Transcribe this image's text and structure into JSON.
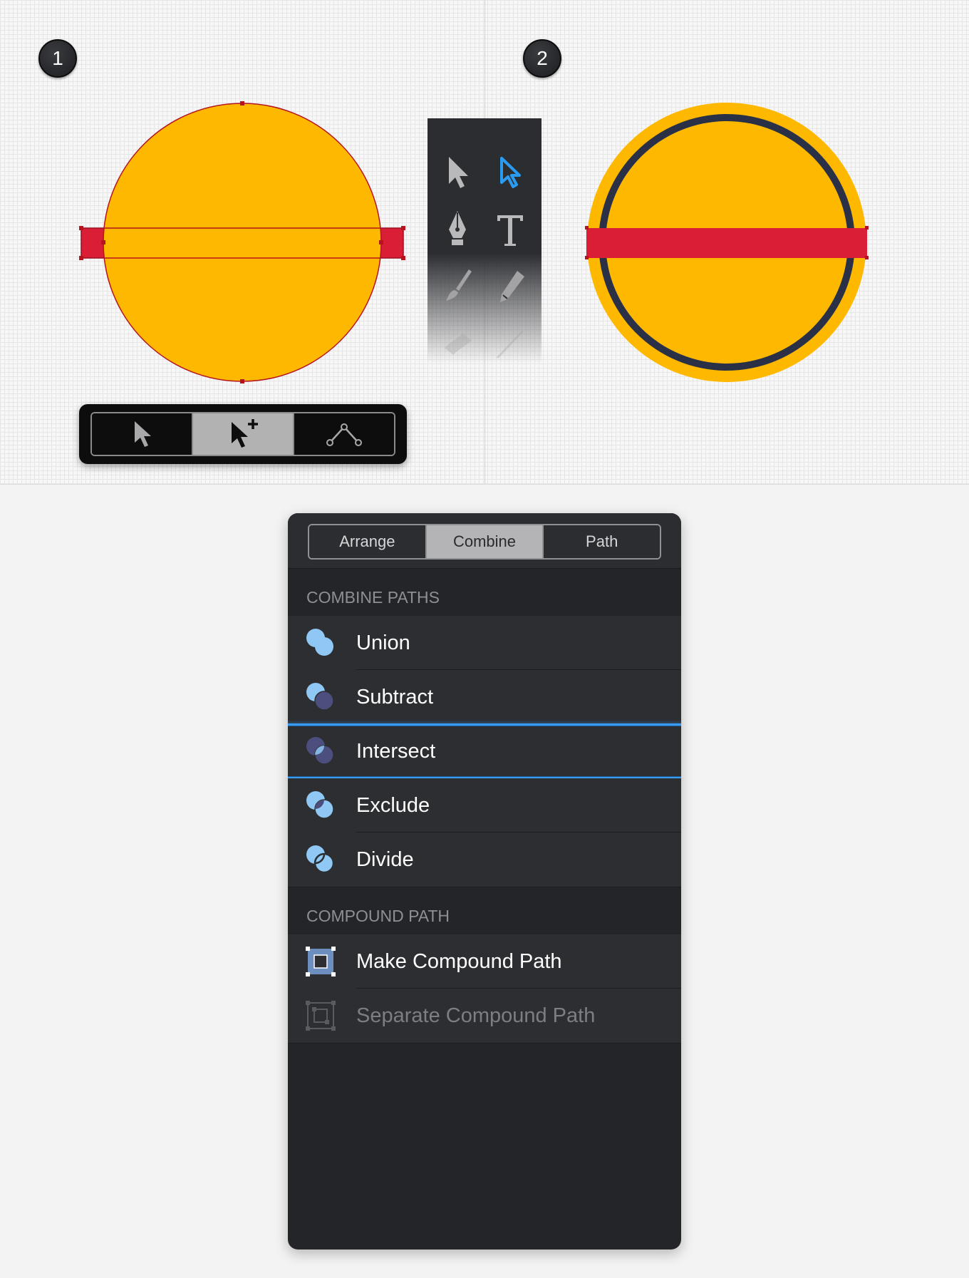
{
  "steps": {
    "step1": "1",
    "step2": "2"
  },
  "colors": {
    "yellow": "#FFB800",
    "red": "#D91E36",
    "navy": "#2A3146",
    "selection_blue": "#3A9CF0"
  },
  "tools_palette": {
    "tools": [
      "selection-tool-icon",
      "direct-selection-tool-icon",
      "pen-tool-icon",
      "text-tool-icon",
      "brush-tool-icon",
      "pencil-tool-icon",
      "eraser-tool-icon",
      "line-tool-icon"
    ]
  },
  "select_mode_bar": {
    "modes": [
      "select-arrow-icon",
      "add-to-selection-icon",
      "node-edit-icon"
    ],
    "active": "add-to-selection-icon"
  },
  "inspector": {
    "tabs": [
      {
        "label": "Arrange"
      },
      {
        "label": "Combine"
      },
      {
        "label": "Path"
      }
    ],
    "active_tab": "Combine",
    "combine_paths": {
      "header": "COMBINE PATHS",
      "items": [
        {
          "label": "Union",
          "icon": "union-icon"
        },
        {
          "label": "Subtract",
          "icon": "subtract-icon"
        },
        {
          "label": "Intersect",
          "icon": "intersect-icon"
        },
        {
          "label": "Exclude",
          "icon": "exclude-icon"
        },
        {
          "label": "Divide",
          "icon": "divide-icon"
        }
      ],
      "selected": "Intersect"
    },
    "compound_path": {
      "header": "COMPOUND PATH",
      "items": [
        {
          "label": "Make Compound Path",
          "icon": "make-compound-path-icon"
        },
        {
          "label": "Separate Compound Path",
          "icon": "separate-compound-path-icon"
        }
      ],
      "disabled": "Separate Compound Path"
    }
  }
}
